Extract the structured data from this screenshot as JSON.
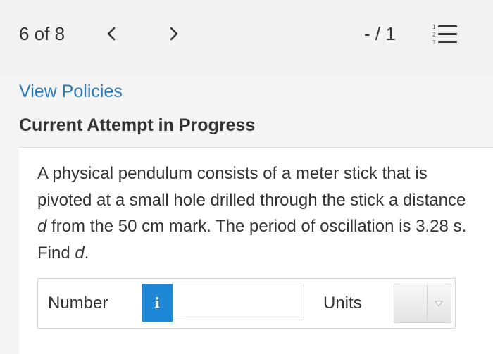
{
  "header": {
    "counter": "6 of 8",
    "score": "- / 1",
    "prev_icon": "chevron-left-icon",
    "next_icon": "chevron-right-icon",
    "list_icon": "numbered-list-icon"
  },
  "links": {
    "view_policies": "View Policies"
  },
  "status": {
    "attempt": "Current Attempt in Progress"
  },
  "question": {
    "text_part1": "A physical pendulum consists of a meter stick that is pivoted at a small hole drilled through the stick a distance ",
    "variable_d": "d",
    "text_part2": " from the 50 cm mark. The period of oscillation is 3.28 s. Find ",
    "variable_d2": "d",
    "text_part3": "."
  },
  "answer": {
    "number_label": "Number",
    "info_label": "i",
    "number_value": "",
    "units_label": "Units",
    "units_selected": ""
  },
  "colors": {
    "link": "#2a7ab8",
    "info_button": "#1e88d6",
    "text": "#333333",
    "background": "#f2f2f2"
  }
}
